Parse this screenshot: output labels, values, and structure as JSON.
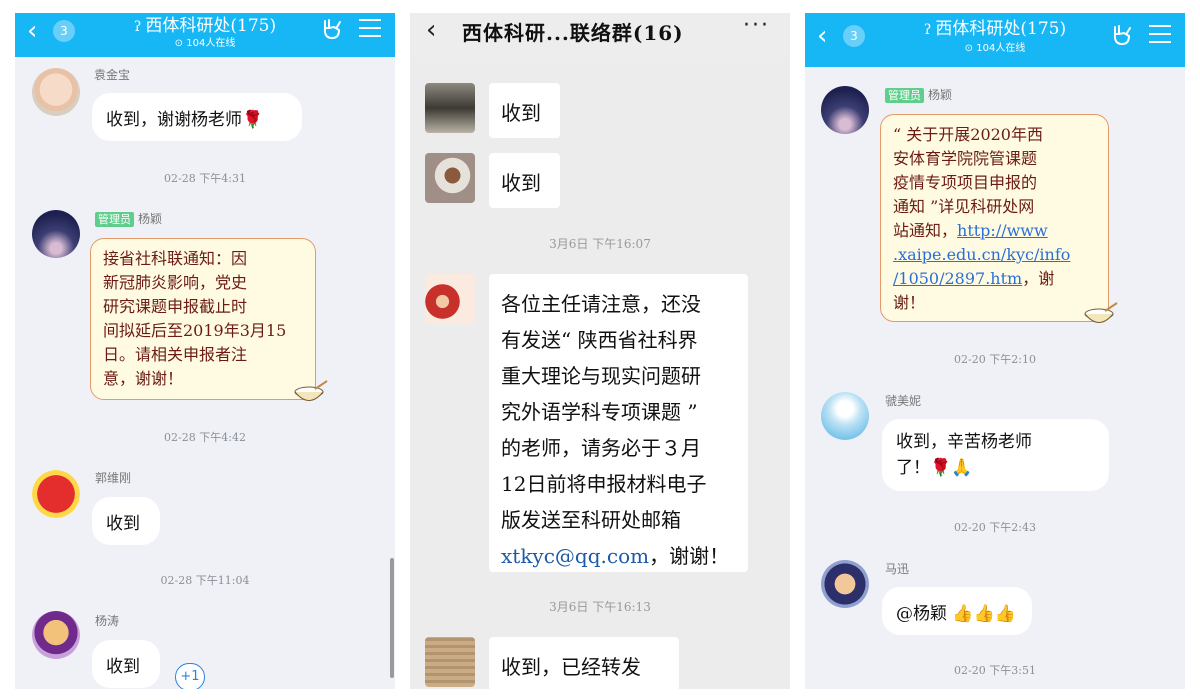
{
  "panel1": {
    "header": {
      "back_count": "3",
      "title": "西体科研处(175)",
      "online": "104人在线"
    },
    "messages": [
      {
        "sender": "袁金宝",
        "text": "收到，谢谢杨老师"
      },
      {
        "time": "02-28 下午4:31"
      },
      {
        "role": "管理员",
        "sender": "杨颖",
        "lines": [
          "接省社科联通知：因",
          "新冠肺炎影响，党史",
          "研究课题申报截止时",
          "间拟延后至2019年3月15",
          "日。请相关申报者注",
          "意，谢谢！"
        ]
      },
      {
        "time": "02-28 下午4:42"
      },
      {
        "sender": "郭维刚",
        "text": "收到"
      },
      {
        "time": "02-28 下午11:04"
      },
      {
        "sender": "杨涛",
        "text": "收到"
      }
    ],
    "plus_one": "+1"
  },
  "panel2": {
    "header": {
      "title": "西体科研...联络群(16)",
      "more": "···"
    },
    "messages": [
      {
        "text": "收到"
      },
      {
        "text": "收到"
      },
      {
        "time": "3月6日 下午16:07"
      },
      {
        "lines": [
          "各位主任请注意，还没",
          "有发送“ 陕西省社科界",
          "重大理论与现实问题研",
          "究外语学科专项课题 ”",
          "的老师，请务必于３月",
          "12日前将申报材料电子",
          "版发送至科研处邮箱"
        ],
        "email": "xtkyc@qq.com",
        "tail": "，谢谢！"
      },
      {
        "time": "3月6日 下午16:13"
      },
      {
        "text": "收到，已经转发"
      }
    ]
  },
  "panel3": {
    "header": {
      "back_count": "3",
      "title": "西体科研处(175)",
      "online": "104人在线"
    },
    "messages": [
      {
        "role": "管理员",
        "sender": "杨颖",
        "lines": [
          "“ 关于开展2020年西",
          "安体育学院院管课题",
          "疫情专项项目申报的",
          "通知 ”详见科研处网",
          "站通知，"
        ],
        "link": [
          "http://www",
          ".xaipe.edu.cn/kyc/info",
          "/1050/2897.htm"
        ],
        "tail": "，谢",
        "end": "谢！"
      },
      {
        "time": "02-20 下午2:10"
      },
      {
        "sender": "虢美妮",
        "lines": [
          "收到，辛苦杨老师",
          "了！"
        ]
      },
      {
        "time": "02-20 下午2:43"
      },
      {
        "sender": "马迅",
        "text": "@杨颖"
      },
      {
        "time": "02-20 下午3:51"
      }
    ]
  },
  "colors": {
    "qq_header": "#17b6f5",
    "wechat_bg": "#ececec",
    "admin_tag": "#5fce8c",
    "fancy_bubble": "#fffbe2",
    "link": "#2a6fd6"
  }
}
